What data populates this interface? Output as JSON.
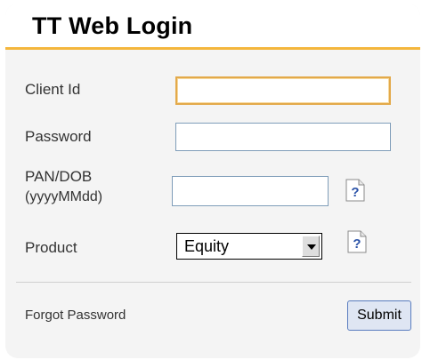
{
  "header": {
    "title": "TT Web Login"
  },
  "form": {
    "client_id": {
      "label": "Client Id",
      "value": ""
    },
    "password": {
      "label": "Password",
      "value": ""
    },
    "pan_dob": {
      "label_line1": "PAN/DOB",
      "label_line2": "(yyyyMMdd)",
      "value": ""
    },
    "product": {
      "label": "Product",
      "selected": "Equity"
    },
    "help_icon_glyph": "?"
  },
  "footer": {
    "forgot_password_label": "Forgot Password",
    "submit_label": "Submit"
  },
  "colors": {
    "accent": "#f4b63c",
    "focus_border": "#e3a94a",
    "input_border": "#7f9db9",
    "submit_bg": "#dfe6f3",
    "help_icon": "#2b53a8"
  }
}
